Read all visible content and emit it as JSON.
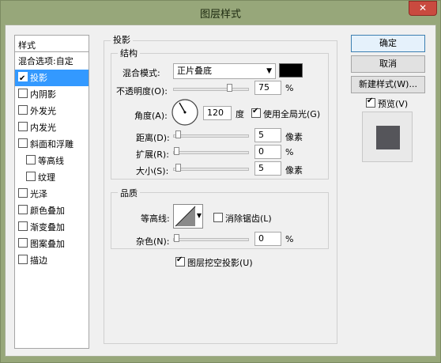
{
  "window": {
    "title": "图层样式",
    "close_glyph": "✕"
  },
  "styles_panel": {
    "header": "样式",
    "items": [
      {
        "label": "混合选项:自定",
        "checkbox": false,
        "selected": false,
        "indent": false
      },
      {
        "label": "投影",
        "checkbox": true,
        "checked": true,
        "selected": true,
        "indent": false
      },
      {
        "label": "内阴影",
        "checkbox": true,
        "checked": false,
        "selected": false,
        "indent": false
      },
      {
        "label": "外发光",
        "checkbox": true,
        "checked": false,
        "selected": false,
        "indent": false
      },
      {
        "label": "内发光",
        "checkbox": true,
        "checked": false,
        "selected": false,
        "indent": false
      },
      {
        "label": "斜面和浮雕",
        "checkbox": true,
        "checked": false,
        "selected": false,
        "indent": false
      },
      {
        "label": "等高线",
        "checkbox": true,
        "checked": false,
        "selected": false,
        "indent": true
      },
      {
        "label": "纹理",
        "checkbox": true,
        "checked": false,
        "selected": false,
        "indent": true
      },
      {
        "label": "光泽",
        "checkbox": true,
        "checked": false,
        "selected": false,
        "indent": false
      },
      {
        "label": "颜色叠加",
        "checkbox": true,
        "checked": false,
        "selected": false,
        "indent": false
      },
      {
        "label": "渐变叠加",
        "checkbox": true,
        "checked": false,
        "selected": false,
        "indent": false
      },
      {
        "label": "图案叠加",
        "checkbox": true,
        "checked": false,
        "selected": false,
        "indent": false
      },
      {
        "label": "描边",
        "checkbox": true,
        "checked": false,
        "selected": false,
        "indent": false
      }
    ]
  },
  "drop_shadow": {
    "section_title": "投影",
    "structure": {
      "title": "结构",
      "blend_mode_label": "混合模式:",
      "blend_mode_value": "正片叠底",
      "blend_color": "#000000",
      "opacity_label": "不透明度(O):",
      "opacity_value": "75",
      "opacity_level": 0.75,
      "opacity_unit": "%",
      "angle_label": "角度(A):",
      "angle_value": "120",
      "angle_unit": "度",
      "global_light_label": "使用全局光(G)",
      "global_light_checked": true,
      "distance_label": "距离(D):",
      "distance_value": "5",
      "distance_unit": "像素",
      "spread_label": "扩展(R):",
      "spread_value": "0",
      "spread_unit": "%",
      "size_label": "大小(S):",
      "size_value": "5",
      "size_unit": "像素"
    },
    "quality": {
      "title": "品质",
      "contour_label": "等高线:",
      "antialias_label": "消除锯齿(L)",
      "antialias_checked": false,
      "noise_label": "杂色(N):",
      "noise_value": "0",
      "noise_unit": "%"
    },
    "knockout_label": "图层挖空投影(U)",
    "knockout_checked": true
  },
  "buttons": {
    "ok": "确定",
    "cancel": "取消",
    "new_style": "新建样式(W)...",
    "preview_label": "预览(V)",
    "preview_checked": true
  },
  "colors": {
    "titlebar": "#97a77a",
    "selection": "#3399ff",
    "preview_swatch": "#55555a"
  }
}
